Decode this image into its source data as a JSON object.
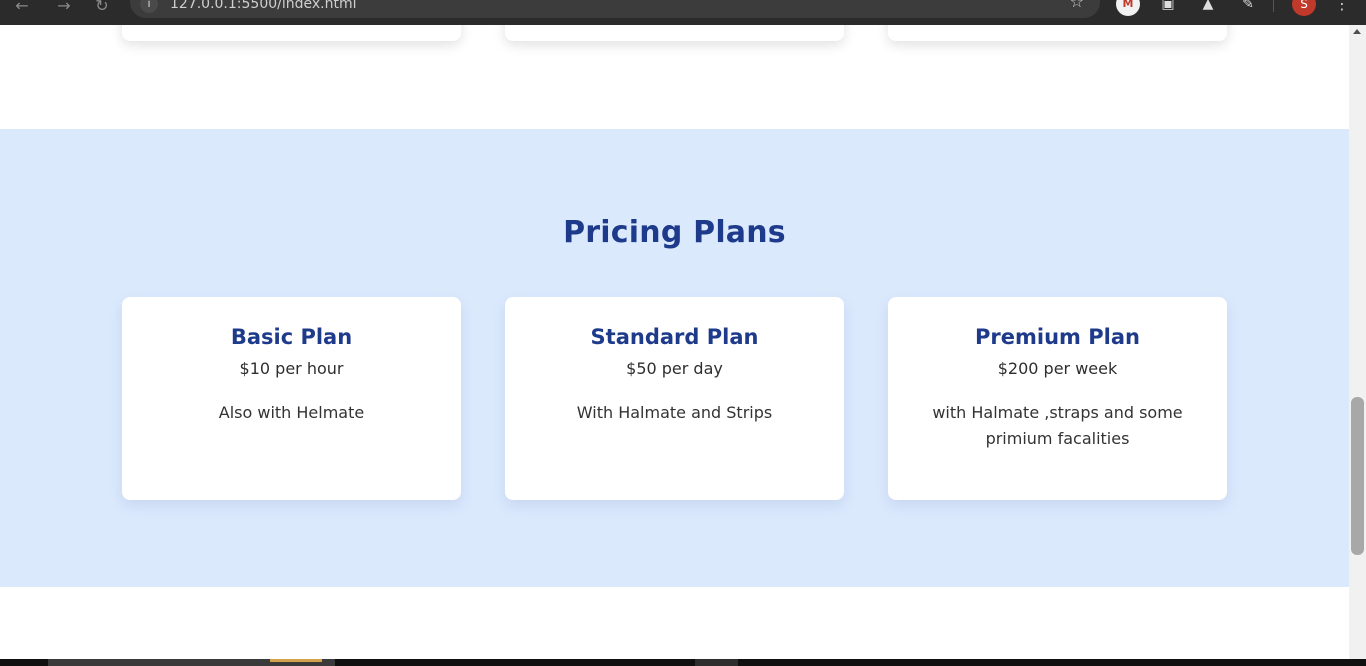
{
  "browser": {
    "url": "127.0.0.1:5500/index.html",
    "extensions": [
      "M",
      "image-extension",
      "hat-extension",
      "puzzle-extension"
    ],
    "profile_initial": "S"
  },
  "pricing": {
    "title": "Pricing Plans",
    "plans": [
      {
        "name": "Basic Plan",
        "price": "$10 per hour",
        "description": "Also with Helmate"
      },
      {
        "name": "Standard Plan",
        "price": "$50 per day",
        "description": "With Halmate and Strips"
      },
      {
        "name": "Premium Plan",
        "price": "$200 per week",
        "description": "with Halmate ,straps and some primium facalities"
      }
    ]
  },
  "colors": {
    "section_bg": "#dbe9fd",
    "heading": "#1e3a8a",
    "card_bg": "#ffffff"
  }
}
